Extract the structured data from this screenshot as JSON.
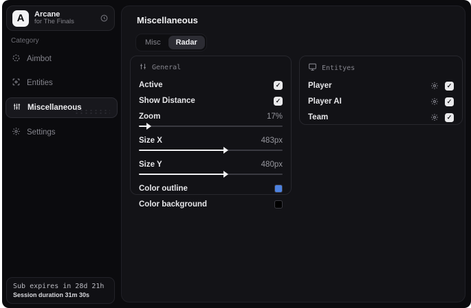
{
  "app": {
    "name": "Arcane",
    "subtitle": "for The Finals",
    "logo_letter": "A"
  },
  "colors": {
    "accent_red": "#d4164a",
    "swatch_blue": "#4d82e0",
    "swatch_black": "#000000",
    "checkbox_bg": "#e9e9eb"
  },
  "sidebar": {
    "category_label": "Category",
    "items": [
      {
        "label": "Aimbot",
        "icon": "crosshair-icon",
        "selected": false
      },
      {
        "label": "Entities",
        "icon": "scan-box-icon",
        "selected": false
      },
      {
        "label": "Miscellaneous",
        "icon": "sliders-vertical-icon",
        "selected": true
      },
      {
        "label": "Settings",
        "icon": "gear-icon",
        "selected": false
      }
    ],
    "footer": {
      "line1": "Sub expires in 28d 21h",
      "line2": "Session duration 31m 30s"
    }
  },
  "main": {
    "title": "Miscellaneous",
    "tabs": [
      {
        "label": "Misc",
        "selected": false
      },
      {
        "label": "Radar",
        "selected": true
      }
    ],
    "panels": {
      "general": {
        "title": "General",
        "icon": "sliders-icon",
        "toggles": [
          {
            "label": "Active",
            "checked": true,
            "check_glyph": "✓"
          },
          {
            "label": "Show Distance",
            "checked": true,
            "check_glyph": "✓"
          }
        ],
        "sliders": [
          {
            "label": "Zoom",
            "value": "17%",
            "fill_percent": 6
          },
          {
            "label": "Size X",
            "value": "483px",
            "fill_percent": 60
          },
          {
            "label": "Size Y",
            "value": "480px",
            "fill_percent": 60
          }
        ],
        "colors": [
          {
            "label": "Color outline",
            "swatch": "#4d82e0"
          },
          {
            "label": "Color background",
            "swatch": "#000000"
          }
        ]
      },
      "entities": {
        "title": "Entityes",
        "icon": "monitor-icon",
        "rows": [
          {
            "label": "Player",
            "checked": true,
            "check_glyph": "✓"
          },
          {
            "label": "Player AI",
            "checked": true,
            "check_glyph": "✓"
          },
          {
            "label": "Team",
            "checked": true,
            "check_glyph": "✓"
          }
        ]
      }
    }
  }
}
